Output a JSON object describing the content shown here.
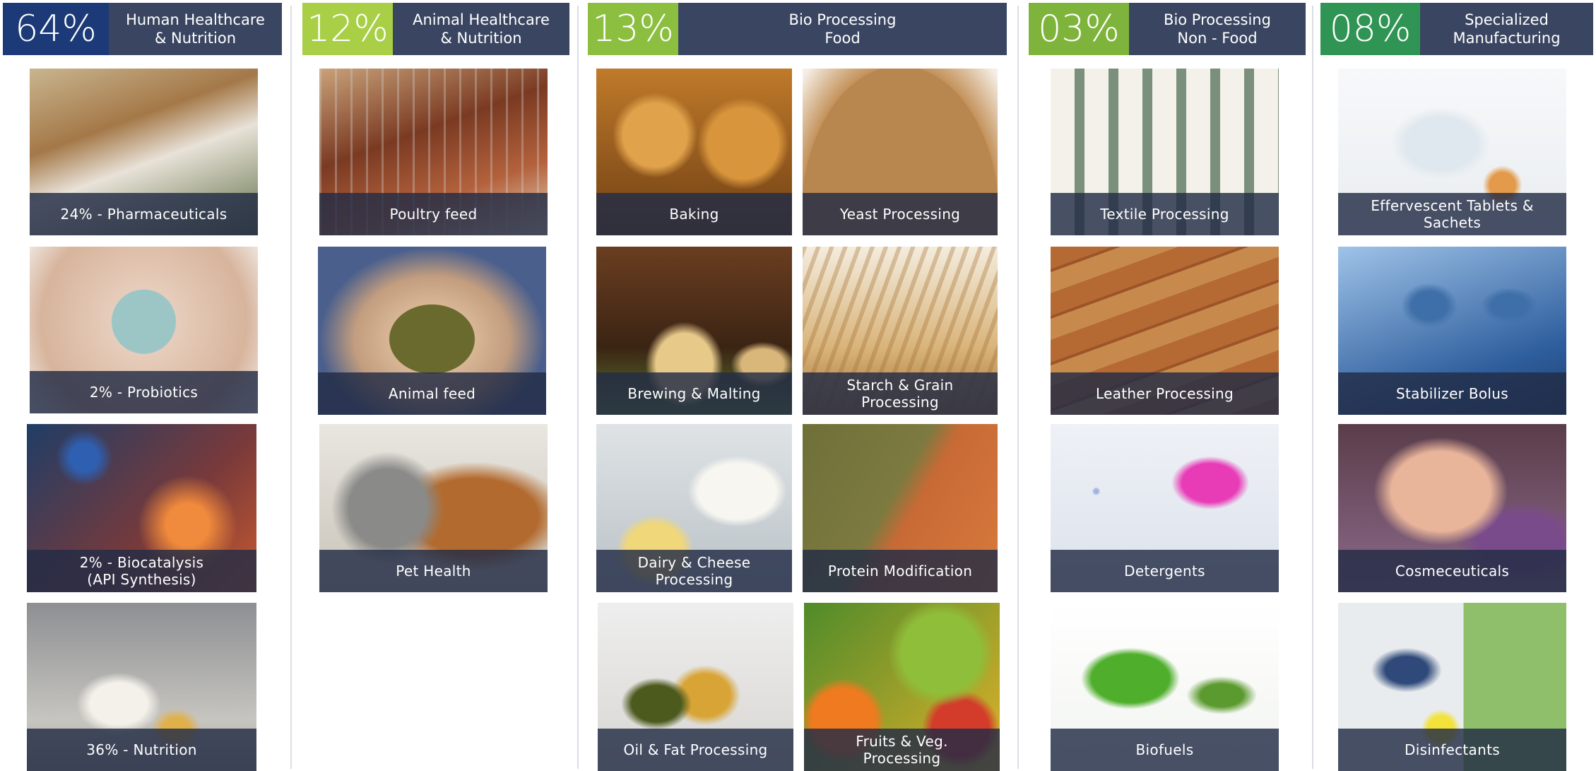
{
  "colors": {
    "header_text_bg": "#3a4661",
    "caption_bg": "#222c46",
    "divider": "#d9dde3"
  },
  "columns": [
    {
      "percent": "64%",
      "percent_color": "#1c3a78",
      "title": "Human Healthcare\n& Nutrition",
      "tiles": [
        {
          "caption": "24% - Pharmaceuticals",
          "image": "family-photo"
        },
        {
          "caption": "2% - Probiotics",
          "image": "belly-photo"
        },
        {
          "caption": "2% - Biocatalysis\n(API Synthesis)",
          "image": "lab-flasks-photo"
        },
        {
          "caption": "36% - Nutrition",
          "image": "supplements-photo"
        }
      ]
    },
    {
      "percent": "12%",
      "percent_color": "#a8cf45",
      "title": "Animal Healthcare\n& Nutrition",
      "tiles": [
        {
          "caption": "Poultry feed",
          "image": "chickens-photo"
        },
        {
          "caption": "Animal feed",
          "image": "feed-pellets-photo"
        },
        {
          "caption": "Pet Health",
          "image": "cat-dog-photo"
        }
      ]
    },
    {
      "percent": "13%",
      "percent_color": "#8cbf3f",
      "title": "Bio Processing\nFood",
      "tiles": [
        {
          "caption": "Baking",
          "image": "bread-rolls-photo"
        },
        {
          "caption": "Yeast Processing",
          "image": "yeast-powder-photo"
        },
        {
          "caption": "Brewing & Malting",
          "image": "cheese-wheels-photo"
        },
        {
          "caption": "Starch & Grain\nProcessing",
          "image": "wheat-photo"
        },
        {
          "caption": "Dairy & Cheese\nProcessing",
          "image": "milk-cheese-photo"
        },
        {
          "caption": "Protein Modification",
          "image": "lentils-photo"
        },
        {
          "caption": "Oil & Fat Processing",
          "image": "oil-bottles-photo"
        },
        {
          "caption": "Fruits & Veg.\nProcessing",
          "image": "fruits-veg-photo"
        }
      ]
    },
    {
      "percent": "03%",
      "percent_color": "#7fb43c",
      "title": "Bio Processing\nNon - Food",
      "tiles": [
        {
          "caption": "Textile Processing",
          "image": "spindles-photo"
        },
        {
          "caption": "Leather Processing",
          "image": "leather-photo"
        },
        {
          "caption": "Detergents",
          "image": "detergent-scoop-photo"
        },
        {
          "caption": "Biofuels",
          "image": "fuel-nozzle-photo"
        }
      ]
    },
    {
      "percent": "08%",
      "percent_color": "#2f9454",
      "title": "Specialized\nManufacturing",
      "tiles": [
        {
          "caption": "Effervescent Tablets &\nSachets",
          "image": "water-glass-photo"
        },
        {
          "caption": "Stabilizer Bolus",
          "image": "vials-syringe-photo"
        },
        {
          "caption": "Cosmeceuticals",
          "image": "foot-spa-photo"
        },
        {
          "caption": "Disinfectants",
          "image": "mopping-photo"
        }
      ]
    }
  ]
}
